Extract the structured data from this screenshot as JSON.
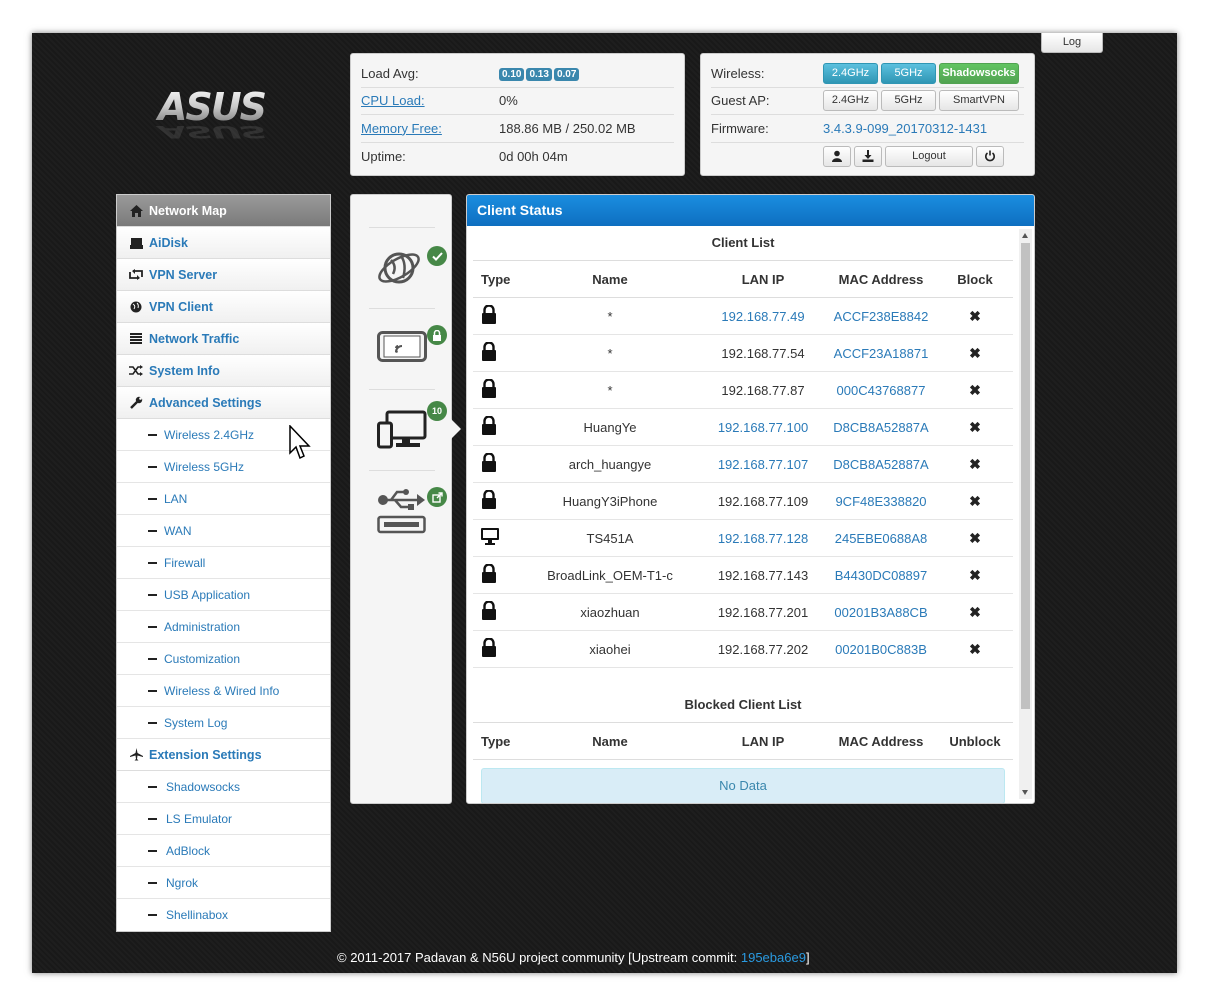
{
  "log_tab": "Log",
  "system": {
    "load_avg_label": "Load Avg:",
    "load_avg": [
      "0.10",
      "0.13",
      "0.07"
    ],
    "cpu_label": "CPU Load:",
    "cpu_value": "0%",
    "mem_label": "Memory Free:",
    "mem_value": "188.86 MB / 250.02 MB",
    "uptime_label": "Uptime:",
    "uptime_value": "0d 00h 04m"
  },
  "wireless": {
    "wireless_label": "Wireless:",
    "btn_24": "2.4GHz",
    "btn_5": "5GHz",
    "btn_ss": "Shadowsocks",
    "guest_label": "Guest AP:",
    "guest_24": "2.4GHz",
    "guest_5": "5GHz",
    "guest_vpn": "SmartVPN",
    "fw_label": "Firmware:",
    "fw_value": "3.4.3.9-099_20170312-1431",
    "logout": "Logout"
  },
  "sidebar": {
    "network_map": "Network Map",
    "aidisk": "AiDisk",
    "vpn_server": "VPN Server",
    "vpn_client": "VPN Client",
    "network_traffic": "Network Traffic",
    "system_info": "System Info",
    "advanced_settings": "Advanced Settings",
    "adv": [
      "Wireless 2.4GHz",
      "Wireless 5GHz",
      "LAN",
      "WAN",
      "Firewall",
      "USB Application",
      "Administration",
      "Customization",
      "Wireless & Wired Info",
      "System Log"
    ],
    "extension_settings": "Extension Settings",
    "ext": [
      "Shadowsocks",
      "LS Emulator",
      "AdBlock",
      "Ngrok",
      "Shellinabox"
    ]
  },
  "icons": {
    "clients_count": "10"
  },
  "client_status": {
    "title": "Client Status",
    "client_list_title": "Client List",
    "headers": {
      "type": "Type",
      "name": "Name",
      "ip": "LAN IP",
      "mac": "MAC Address",
      "block": "Block"
    },
    "clients": [
      {
        "type": "lock",
        "name": "*",
        "ip": "192.168.77.49",
        "ip_link": true,
        "mac": "ACCF238E8842",
        "mac_link": true
      },
      {
        "type": "lock",
        "name": "*",
        "ip": "192.168.77.54",
        "ip_link": false,
        "mac": "ACCF23A18871",
        "mac_link": true
      },
      {
        "type": "lock",
        "name": "*",
        "ip": "192.168.77.87",
        "ip_link": false,
        "mac": "000C43768877",
        "mac_link": true
      },
      {
        "type": "lock",
        "name": "HuangYe",
        "ip": "192.168.77.100",
        "ip_link": true,
        "mac": "D8CB8A52887A",
        "mac_link": true
      },
      {
        "type": "lock",
        "name": "arch_huangye",
        "ip": "192.168.77.107",
        "ip_link": true,
        "mac": "D8CB8A52887A",
        "mac_link": true
      },
      {
        "type": "lock",
        "name": "HuangY3iPhone",
        "ip": "192.168.77.109",
        "ip_link": false,
        "mac": "9CF48E338820",
        "mac_link": true
      },
      {
        "type": "pc",
        "name": "TS451A",
        "ip": "192.168.77.128",
        "ip_link": true,
        "mac": "245EBE0688A8",
        "mac_link": true
      },
      {
        "type": "lock",
        "name": "BroadLink_OEM-T1-c",
        "ip": "192.168.77.143",
        "ip_link": false,
        "mac": "B4430DC08897",
        "mac_link": true
      },
      {
        "type": "lock",
        "name": "xiaozhuan",
        "ip": "192.168.77.201",
        "ip_link": false,
        "mac": "00201B3A88CB",
        "mac_link": true
      },
      {
        "type": "lock",
        "name": "xiaohei",
        "ip": "192.168.77.202",
        "ip_link": false,
        "mac": "00201B0C883B",
        "mac_link": true
      }
    ],
    "blocked_title": "Blocked Client List",
    "blocked_headers": {
      "type": "Type",
      "name": "Name",
      "ip": "LAN IP",
      "mac": "MAC Address",
      "unblock": "Unblock"
    },
    "no_data": "No Data"
  },
  "footer": {
    "text": "© 2011-2017 Padavan & N56U project community  [Upstream commit: ",
    "commit": "195eba6e9",
    "close": "]"
  }
}
